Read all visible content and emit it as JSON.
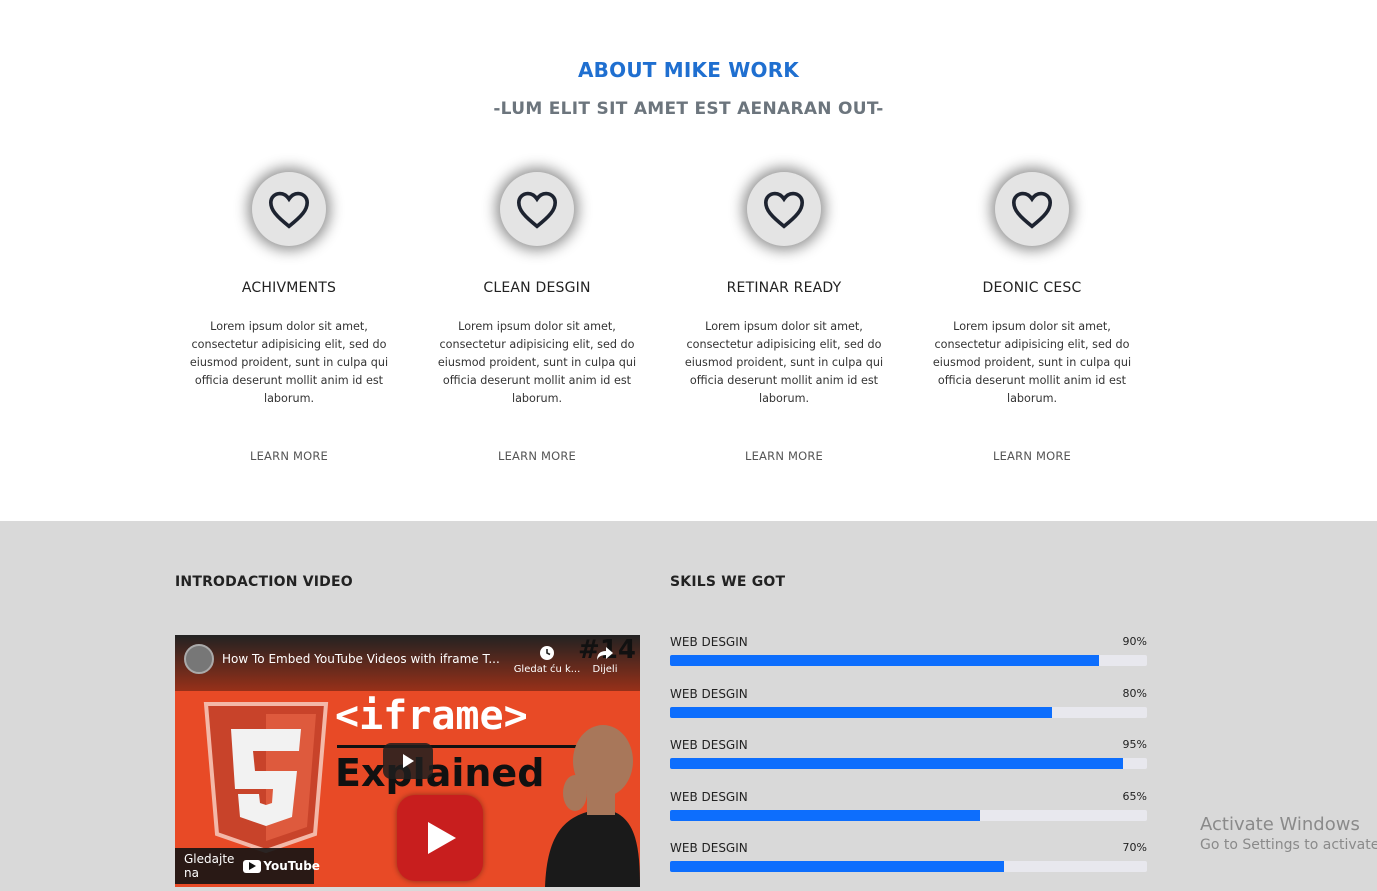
{
  "about": {
    "title": "ABOUT MIKE WORK",
    "subtitle": "-LUM ELIT SIT AMET EST AENARAN OUT-"
  },
  "features": [
    {
      "icon": "heart-icon",
      "title": "ACHIVMENTS",
      "text": "Lorem ipsum dolor sit amet, consectetur adipisicing elit, sed do eiusmod proident, sunt in culpa qui officia deserunt mollit anim id est laborum.",
      "link": "LEARN MORE"
    },
    {
      "icon": "heart-icon",
      "title": "CLEAN DESGIN",
      "text": "Lorem ipsum dolor sit amet, consectetur adipisicing elit, sed do eiusmod proident, sunt in culpa qui officia deserunt mollit anim id est laborum.",
      "link": "LEARN MORE"
    },
    {
      "icon": "heart-icon",
      "title": "RETINAR READY",
      "text": "Lorem ipsum dolor sit amet, consectetur adipisicing elit, sed do eiusmod proident, sunt in culpa qui officia deserunt mollit anim id est laborum.",
      "link": "LEARN MORE"
    },
    {
      "icon": "heart-icon",
      "title": "DEONIC CESC",
      "text": "Lorem ipsum dolor sit amet, consectetur adipisicing elit, sed do eiusmod proident, sunt in culpa qui officia deserunt mollit anim id est laborum.",
      "link": "LEARN MORE"
    }
  ],
  "video_section": {
    "label": "INTRODACTION VIDEO",
    "video_title": "How To Embed YouTube Videos with iframe T...",
    "watch_later": "Gledat ću k...",
    "share": "Dijeli",
    "episode": "#14",
    "thumb_line1": "<iframe>",
    "thumb_line2": "Explained",
    "watch_on": "Gledajte na",
    "youtube": "YouTube"
  },
  "skills_section": {
    "label": "SKILS WE GOT",
    "accent": "#0d6efd",
    "skills": [
      {
        "name": "WEB DESGIN",
        "percent_label": "90%",
        "value": 90
      },
      {
        "name": "WEB DESGIN",
        "percent_label": "80%",
        "value": 80
      },
      {
        "name": "WEB DESGIN",
        "percent_label": "95%",
        "value": 95
      },
      {
        "name": "WEB DESGIN",
        "percent_label": "65%",
        "value": 65
      },
      {
        "name": "WEB DESGIN",
        "percent_label": "70%",
        "value": 70
      }
    ]
  },
  "watermark": {
    "line1": "Activate Windows",
    "line2": "Go to Settings to activate W"
  },
  "colors": {
    "title_blue": "#1f6fd0",
    "bottom_bg": "#d9d9d9"
  }
}
